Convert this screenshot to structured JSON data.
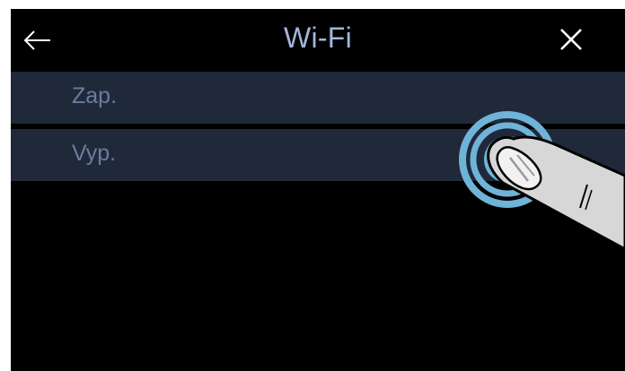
{
  "header": {
    "title": "Wi-Fi",
    "back_icon": "arrow-left-icon",
    "close_icon": "close-icon"
  },
  "options": [
    {
      "label": "Zap."
    },
    {
      "label": "Vyp."
    }
  ],
  "overlay": {
    "icon": "tap-finger-icon"
  },
  "colors": {
    "screen_background": "#000000",
    "row_background": "#20293a",
    "title_text": "#a3b6d8",
    "row_text": "#6a7d9c",
    "tap_ring": "#6fb3d8"
  }
}
